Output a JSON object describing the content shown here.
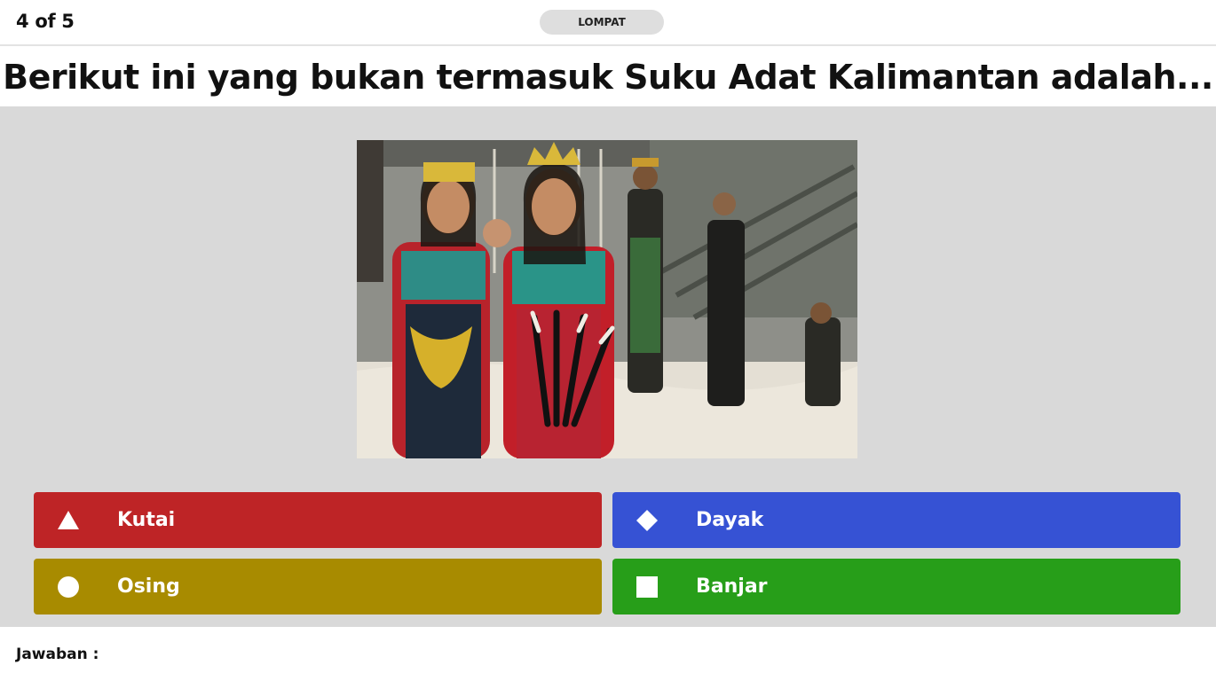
{
  "header": {
    "counter": "4 of 5",
    "skip_label": "LOMPAT"
  },
  "question": {
    "text": "Berikut ini yang bukan termasuk Suku Adat Kalimantan adalah..."
  },
  "answers": [
    {
      "label": "Kutai",
      "shape": "triangle",
      "color": "#be2426"
    },
    {
      "label": "Dayak",
      "shape": "diamond",
      "color": "#3652d4"
    },
    {
      "label": "Osing",
      "shape": "circle",
      "color": "#a88b00"
    },
    {
      "label": "Banjar",
      "shape": "square",
      "color": "#279e19"
    }
  ],
  "footer": {
    "answer_label": "Jawaban :"
  }
}
